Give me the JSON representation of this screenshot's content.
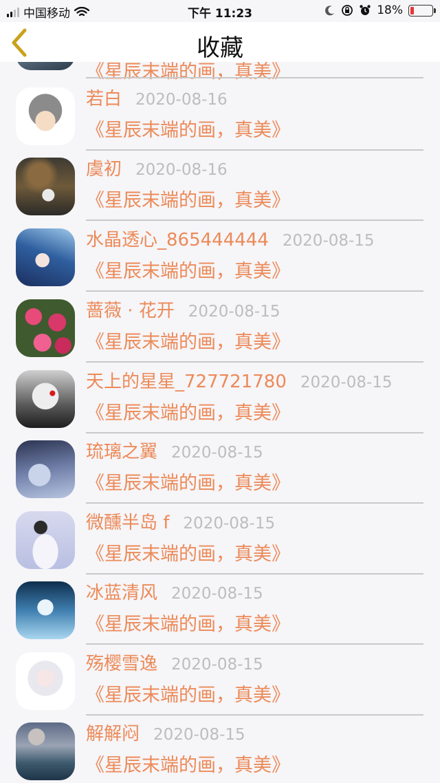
{
  "status_bar": {
    "carrier": "中国移动",
    "time": "下午 11:23",
    "battery": "18%",
    "battery_level": 0.18,
    "icons": [
      "signal-icon",
      "wifi-icon",
      "moon-icon",
      "orientation-lock-icon",
      "alarm-icon",
      "battery-icon"
    ]
  },
  "nav": {
    "title": "收藏",
    "back_icon": "chevron-left-icon"
  },
  "colors": {
    "accent": "#ec8a58",
    "date": "#bdbdbd",
    "divider": "#c9c9c9",
    "background": "#f6f5f8"
  },
  "items": [
    {
      "name": "",
      "date": "",
      "title": "《星辰末端的画，真美》",
      "avatar": "avatar-wavy-dark"
    },
    {
      "name": "若白",
      "date": "2020-08-16",
      "title": "《星辰末端的画，真美》",
      "avatar": "avatar-cartoon-boy"
    },
    {
      "name": "虞初",
      "date": "2020-08-16",
      "title": "《星辰末端的画，真美》",
      "avatar": "avatar-photo-couple"
    },
    {
      "name": "水晶透心_865444444",
      "date": "2020-08-15",
      "title": "《星辰末端的画，真美》",
      "avatar": "avatar-anime-blue-hair"
    },
    {
      "name": "蔷薇 · 花开",
      "date": "2020-08-15",
      "title": "《星辰末端的画，真美》",
      "avatar": "avatar-pink-roses"
    },
    {
      "name": "天上的星星_727721780",
      "date": "2020-08-15",
      "title": "《星辰末端的画，真美》",
      "avatar": "avatar-anime-white-hair"
    },
    {
      "name": "琉璃之翼",
      "date": "2020-08-15",
      "title": "《星辰末端的画，真美》",
      "avatar": "avatar-anime-dark-figure"
    },
    {
      "name": "微醺半岛 f",
      "date": "2020-08-15",
      "title": "《星辰末端的画，真美》",
      "avatar": "avatar-girl-white-coat"
    },
    {
      "name": "冰蓝清风",
      "date": "2020-08-15",
      "title": "《星辰末端的画，真美》",
      "avatar": "avatar-anime-ice-blue"
    },
    {
      "name": "殇樱雪逸",
      "date": "2020-08-15",
      "title": "《星辰末端的画，真美》",
      "avatar": "avatar-anime-white-girl"
    },
    {
      "name": "解解闷",
      "date": "2020-08-15",
      "title": "《星辰末端的画，真美》",
      "avatar": "avatar-seascape"
    }
  ]
}
